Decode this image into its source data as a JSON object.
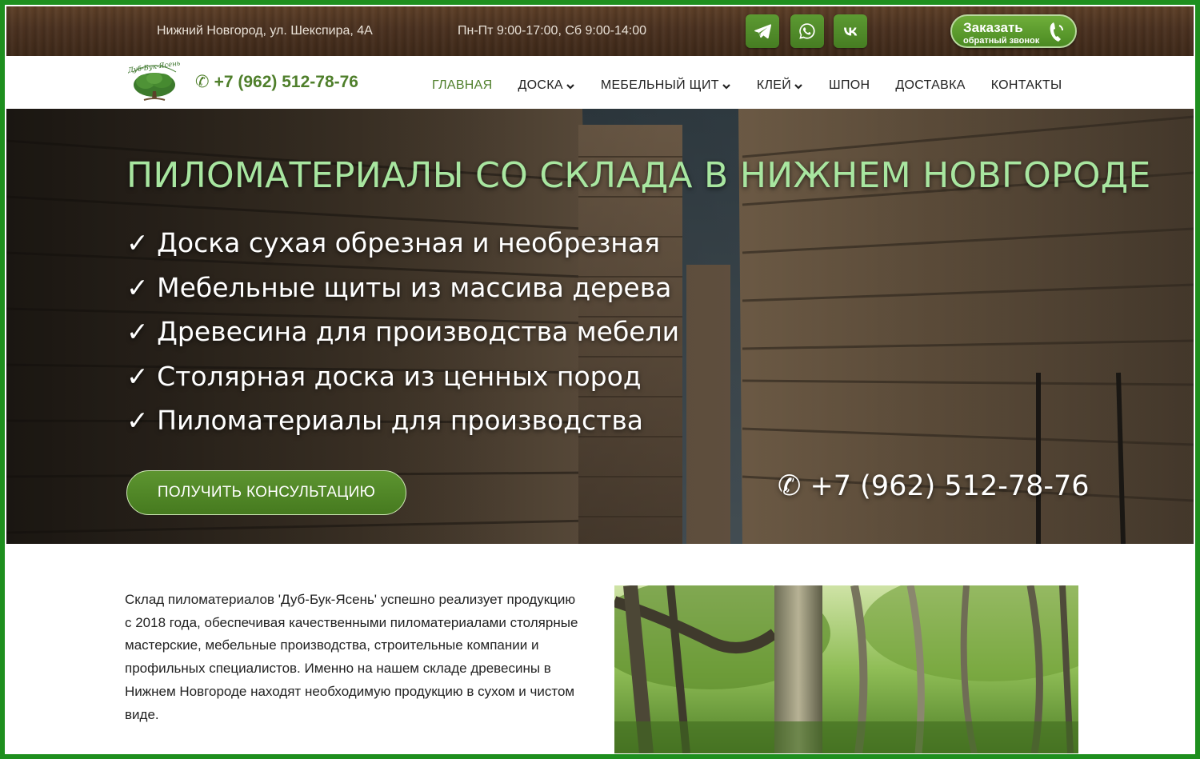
{
  "topbar": {
    "address": "Нижний Новгород, ул. Шекспира, 4А",
    "hours": "Пн-Пт 9:00-17:00, Сб 9:00-14:00",
    "social": [
      "telegram-icon",
      "whatsapp-icon",
      "vk-icon"
    ],
    "callback": {
      "line1": "Заказать",
      "line2": "обратный звонок"
    }
  },
  "nav": {
    "logo_text": "Дуб-Бук-Ясень",
    "phone": "+7 (962) 512-78-76",
    "menu": [
      {
        "label": "ГЛАВНАЯ",
        "active": true,
        "dropdown": false
      },
      {
        "label": "ДОСКА",
        "active": false,
        "dropdown": true
      },
      {
        "label": "МЕБЕЛЬНЫЙ ЩИТ",
        "active": false,
        "dropdown": true
      },
      {
        "label": "КЛЕЙ",
        "active": false,
        "dropdown": true
      },
      {
        "label": "ШПОН",
        "active": false,
        "dropdown": false
      },
      {
        "label": "ДОСТАВКА",
        "active": false,
        "dropdown": false
      },
      {
        "label": "КОНТАКТЫ",
        "active": false,
        "dropdown": false
      }
    ]
  },
  "hero": {
    "title": "ПИЛОМАТЕРИАЛЫ СО СКЛАДА В НИЖНЕМ НОВГОРОДЕ",
    "items": [
      "✓ Доска сухая обрезная и необрезная",
      "✓ Мебельные щиты из массива дерева",
      "✓ Древесина для производства мебели",
      "✓ Столярная доска из ценных пород",
      "✓ Пиломатериалы для производства"
    ],
    "cta": "ПОЛУЧИТЬ КОНСУЛЬТАЦИЮ",
    "phone": "+7 (962) 512-78-76"
  },
  "about": {
    "text": "Склад пиломатериалов 'Дуб-Бук-Ясень' успешно реализует продукцию с 2018 года, обеспечивая качественными пиломатериалами столярные мастерские, мебельные производства, строительные компании и профильных специалистов. Именно на нашем складе древесины в Нижнем Новгороде находят необходимую продукцию в сухом и чистом виде."
  },
  "colors": {
    "frame": "#1e8f1e",
    "accent_green": "#4f7f2b",
    "hero_title": "#a8e6a0",
    "topbar_wood": "#4a3120"
  }
}
